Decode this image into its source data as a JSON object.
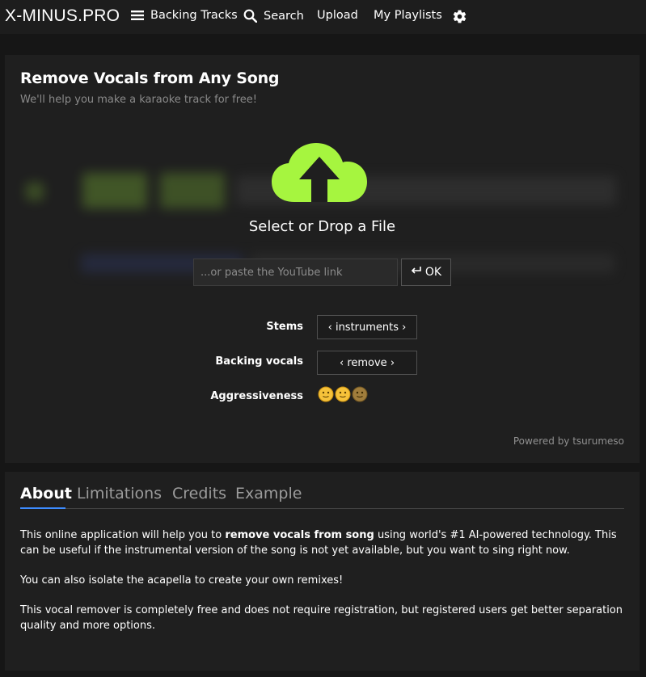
{
  "nav": {
    "logo": "X-MINUS.PRO",
    "backing_tracks": "Backing Tracks",
    "search": "Search",
    "upload": "Upload",
    "my_playlists": "My Playlists",
    "settings_icon": "gear-icon"
  },
  "main": {
    "title": "Remove Vocals from Any Song",
    "subtitle": "We'll help you make a karaoke track for free!",
    "drop_label": "Select or Drop a File",
    "youtube_placeholder": "...or paste the YouTube link",
    "youtube_value": "",
    "ok_label": "OK",
    "stems_label": "Stems",
    "stems_value": "‹ instruments ›",
    "backing_vocals_label": "Backing vocals",
    "backing_vocals_value": "‹ remove ›",
    "aggressiveness_label": "Aggressiveness",
    "aggressiveness": {
      "level": 2,
      "max": 3,
      "icon": "😐"
    },
    "powered_by": "Powered by tsurumeso",
    "accent_color": "#a6f53f"
  },
  "about": {
    "tabs": [
      "About",
      "Limitations",
      "Credits",
      "Example"
    ],
    "active_tab": "About",
    "p1_before": "This online application will help you to ",
    "p1_bold": "remove vocals from song",
    "p1_after": " using world's #1 AI-powered technology. This can be useful if the instrumental version of the song is not yet available, but you want to sing right now.",
    "p2": "You can also isolate the acapella to create your own remixes!",
    "p3": "This vocal remover is completely free and does not require registration, but registered users get better separation quality and more options."
  }
}
